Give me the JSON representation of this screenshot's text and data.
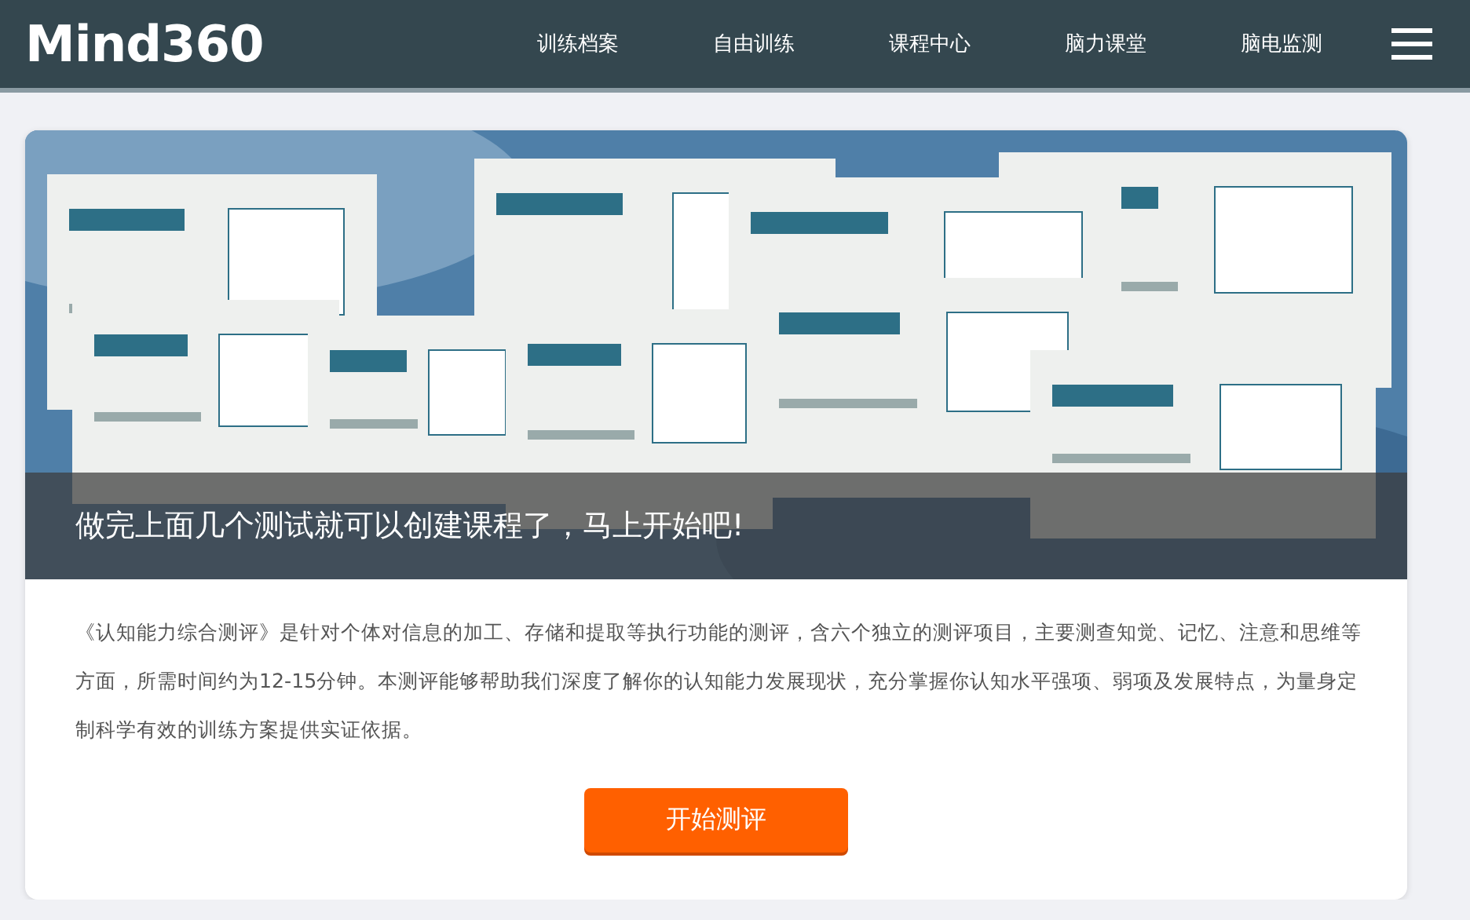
{
  "header": {
    "logo": "Mind360",
    "nav": [
      {
        "label": "训练档案"
      },
      {
        "label": "自由训练"
      },
      {
        "label": "课程中心"
      },
      {
        "label": "脑力课堂"
      },
      {
        "label": "脑电监测"
      }
    ]
  },
  "banner": {
    "caption": "做完上面几个测试就可以创建课程了，马上开始吧!"
  },
  "description": "《认知能力综合测评》是针对个体对信息的加工、存储和提取等执行功能的测评，含六个独立的测评项目，主要测查知觉、记忆、注意和思维等方面，所需时间约为12-15分钟。本测评能够帮助我们深度了解你的认知能力发展现状，充分掌握你认知水平强项、弱项及发展特点，为量身定制科学有效的训练方案提供实证依据。",
  "start_button": "开始测评"
}
